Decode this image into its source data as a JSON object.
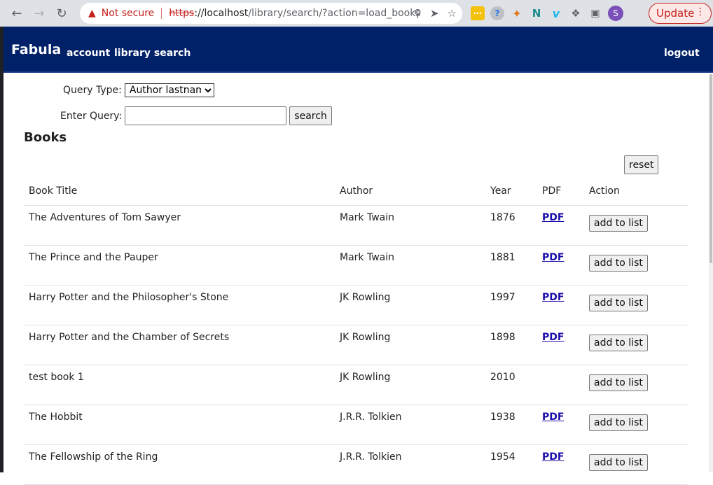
{
  "browser": {
    "security_label": "Not secure",
    "url_scheme": "https",
    "url_host": "://localhost",
    "url_path": "/library/search/?action=load_books",
    "update_label": "Update",
    "profile_initial": "S"
  },
  "navbar": {
    "brand": "Fabula",
    "account": "account",
    "library_search": "library search",
    "logout": "logout"
  },
  "form": {
    "query_type_label": "Query Type:",
    "query_type_selected": "Author lastname",
    "enter_query_label": "Enter Query:",
    "query_value": "",
    "search_label": "search"
  },
  "books": {
    "heading": "Books",
    "reset_label": "reset",
    "columns": [
      "Book Title",
      "Author",
      "Year",
      "PDF",
      "Action"
    ],
    "rows": [
      {
        "title": "The Adventures of Tom Sawyer",
        "author": "Mark Twain",
        "year": "1876",
        "pdf": "PDF",
        "action": "add to list"
      },
      {
        "title": "The Prince and the Pauper",
        "author": "Mark Twain",
        "year": "1881",
        "pdf": "PDF",
        "action": "add to list"
      },
      {
        "title": "Harry Potter and the Philosopher's Stone",
        "author": "JK Rowling",
        "year": "1997",
        "pdf": "PDF",
        "action": "add to list"
      },
      {
        "title": "Harry Potter and the Chamber of Secrets",
        "author": "JK Rowling",
        "year": "1898",
        "pdf": "PDF",
        "action": "add to list"
      },
      {
        "title": "test book 1",
        "author": "JK Rowling",
        "year": "2010",
        "pdf": "",
        "action": "add to list"
      },
      {
        "title": "The Hobbit",
        "author": "J.R.R. Tolkien",
        "year": "1938",
        "pdf": "PDF",
        "action": "add to list"
      },
      {
        "title": "The Fellowship of the Ring",
        "author": "J.R.R. Tolkien",
        "year": "1954",
        "pdf": "PDF",
        "action": "add to list"
      }
    ]
  },
  "colors": {
    "navbar_bg": "#002068",
    "link": "#1a0dab",
    "warning": "#c5221f"
  }
}
